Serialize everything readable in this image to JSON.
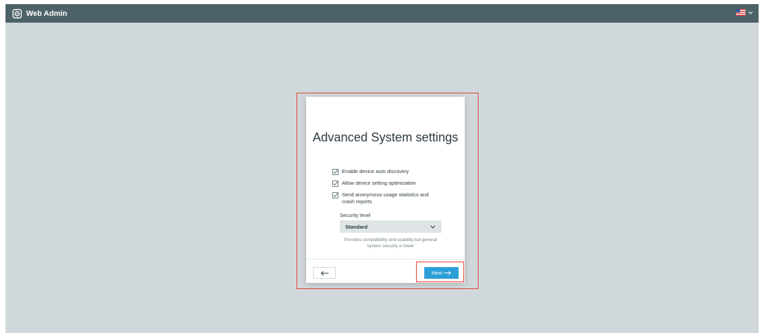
{
  "header": {
    "app_title": "Web Admin",
    "logo_icon": "web-admin-logo-icon",
    "language_icon": "us-flag-icon",
    "language_menu_icon": "chevron-down-icon"
  },
  "dialog": {
    "title": "Advanced System settings",
    "options": [
      {
        "label": "Enable device auto discovery",
        "checked": true
      },
      {
        "label": "Allow device setting optimization",
        "checked": true
      },
      {
        "label": "Send anonymous usage statistics and crash reports",
        "checked": true
      }
    ],
    "security": {
      "label": "Security level",
      "selected": "Standard",
      "description": "Provides compatibility and usability but general system security is lower"
    },
    "back_icon": "arrow-left-icon",
    "next_label": "Next",
    "next_icon": "arrow-right-icon"
  },
  "colors": {
    "topbar": "#4d6269",
    "background": "#d1d8db",
    "primary_button": "#2c9fd6",
    "highlight": "#e0412f"
  }
}
